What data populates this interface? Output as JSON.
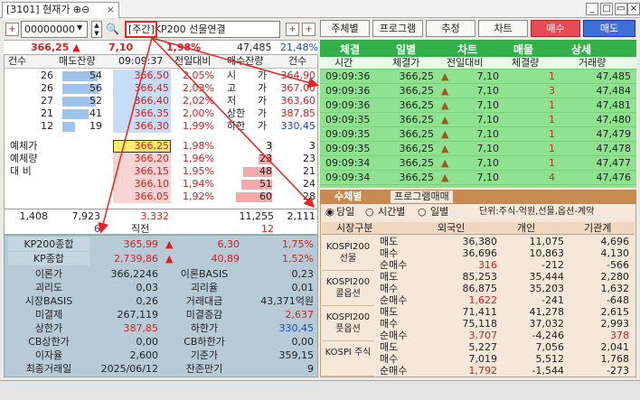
{
  "window": {
    "tab_label": "[3101] 현재가 ⊕⊖",
    "close": "×"
  },
  "toolbar": {
    "code": "00000000",
    "type_tag": "[주간]",
    "product": "KP200 선물연결",
    "b1": "주체별",
    "b2": "프로그램",
    "b3": "추정",
    "b4": "차트",
    "buy": "매수",
    "sell": "매도"
  },
  "summary": {
    "price": "366,25 ▲",
    "change": "7,10",
    "rate": "1,98%",
    "volume": "47,485",
    "ratio": "21,48%"
  },
  "orderbook": {
    "headers": [
      "건수",
      "매도잔량",
      "09:09:37",
      "전일대비",
      "매수잔량",
      "건수"
    ],
    "asks": [
      {
        "cnt": "26",
        "qty": "54",
        "price": "366,50",
        "pct": "2,05%"
      },
      {
        "cnt": "26",
        "qty": "56",
        "price": "366,45",
        "pct": "2,03%"
      },
      {
        "cnt": "27",
        "qty": "52",
        "price": "366,40",
        "pct": "2,02%"
      },
      {
        "cnt": "21",
        "qty": "41",
        "price": "366,35",
        "pct": "2,00%"
      },
      {
        "cnt": "12",
        "qty": "19",
        "price": "366,30",
        "pct": "1,99%"
      }
    ],
    "info": [
      {
        "label": "시",
        "sep": "가",
        "val": "364,90"
      },
      {
        "label": "고",
        "sep": "가",
        "val": "367,00"
      },
      {
        "label": "저",
        "sep": "가",
        "val": "363,60"
      },
      {
        "label": "상한",
        "sep": "가",
        "val": "387,85"
      },
      {
        "label": "하한",
        "sep": "가",
        "val": "330,45"
      }
    ],
    "left_labels": [
      "예체가",
      "예체량",
      "대 비"
    ],
    "bids": [
      {
        "price": "366,25",
        "pct": "1,98%",
        "qty": "3",
        "cnt": "3"
      },
      {
        "price": "366,20",
        "pct": "1,96%",
        "qty": "23",
        "cnt": "23"
      },
      {
        "price": "366,15",
        "pct": "1,95%",
        "qty": "48",
        "cnt": "21"
      },
      {
        "price": "366,10",
        "pct": "1,94%",
        "qty": "51",
        "cnt": "24"
      },
      {
        "price": "366,05",
        "pct": "1,92%",
        "qty": "60",
        "cnt": "28"
      }
    ],
    "foot": {
      "c1": "1,408",
      "c2": "7,923",
      "c3": "3,332",
      "c4": "11,255",
      "c5": "2,111",
      "s1": "6",
      "s2": "직전",
      "s3": "12"
    }
  },
  "bottom": {
    "rows": [
      {
        "l": "KP200종합",
        "v": "365,99",
        "a": "▲",
        "c": "6,30",
        "p": "1,75%"
      },
      {
        "l": "KP종합",
        "v": "2,739,86",
        "a": "▲",
        "c": "40,89",
        "p": "1,52%"
      }
    ],
    "grid": [
      {
        "l1": "이론가",
        "v1": "366,2246",
        "l2": "이론BASIS",
        "v2": "0,23"
      },
      {
        "l1": "괴리도",
        "v1": "0,03",
        "l2": "괴리율",
        "v2": "0,01"
      },
      {
        "l1": "시장BASIS",
        "v1": "0,26",
        "l2": "거래대금",
        "v2": "43,371억원"
      },
      {
        "l1": "미결제",
        "v1": "267,119",
        "l2": "미결증감",
        "v2": "2,637"
      },
      {
        "l1": "상한가",
        "v1": "387,85",
        "l2": "하한가",
        "v2": "330,45"
      },
      {
        "l1": "CB상한가",
        "v1": "0,00",
        "l2": "CB하한가",
        "v2": "0,00"
      },
      {
        "l1": "이자율",
        "v1": "2,600",
        "l2": "기준가",
        "v2": "359,15"
      },
      {
        "l1": "최종거래일",
        "v1": "2025/06/12",
        "l2": "잔존만기",
        "v2": "9"
      }
    ]
  },
  "ticks": {
    "tabs": [
      "체결",
      "일별",
      "차트",
      "매물",
      "상세"
    ],
    "headers": [
      "시간",
      "체결가",
      "전일대비",
      "체결량",
      "거래량"
    ],
    "rows": [
      {
        "t": "09:09:36",
        "p": "366,25",
        "a": "▲",
        "c": "7,10",
        "q": "1",
        "v": "47,485"
      },
      {
        "t": "09:09:36",
        "p": "366,25",
        "a": "▲",
        "c": "7,10",
        "q": "3",
        "v": "47,484"
      },
      {
        "t": "09:09:36",
        "p": "366,25",
        "a": "▲",
        "c": "7,10",
        "q": "1",
        "v": "47,481"
      },
      {
        "t": "09:09:35",
        "p": "366,25",
        "a": "▲",
        "c": "7,10",
        "q": "1",
        "v": "47,480"
      },
      {
        "t": "09:09:35",
        "p": "366,25",
        "a": "▲",
        "c": "7,10",
        "q": "1",
        "v": "47,479"
      },
      {
        "t": "09:09:35",
        "p": "366,25",
        "a": "▲",
        "c": "7,10",
        "q": "1",
        "v": "47,478"
      },
      {
        "t": "09:09:34",
        "p": "366,25",
        "a": "▲",
        "c": "7,10",
        "q": "1",
        "v": "47,477"
      },
      {
        "t": "09:09:34",
        "p": "366,25",
        "a": "▲",
        "c": "7,10",
        "q": "4",
        "v": "47,476"
      }
    ]
  },
  "investor": {
    "tabs": [
      "수체별",
      "프로그램매매"
    ],
    "options": [
      "당일",
      "시간별",
      "일별"
    ],
    "unit": "단위:주식-억원,선물,옵션-계약",
    "headers": [
      "시장구분",
      "외국인",
      "개인",
      "기관계"
    ],
    "groups": [
      {
        "name": "KOSPI200 선물",
        "rows": [
          [
            "매도",
            "36,380",
            "11,075",
            "4,696"
          ],
          [
            "매수",
            "36,696",
            "10,863",
            "4,130"
          ],
          [
            "순매수",
            "316",
            "-212",
            "-566"
          ]
        ]
      },
      {
        "name": "KOSPI200 콜옵션",
        "rows": [
          [
            "매도",
            "85,253",
            "35,444",
            "2,280"
          ],
          [
            "매수",
            "86,875",
            "35,203",
            "1,632"
          ],
          [
            "순매수",
            "1,622",
            "-241",
            "-648"
          ]
        ]
      },
      {
        "name": "KOSPI200 풋옵션",
        "rows": [
          [
            "매도",
            "71,411",
            "41,278",
            "2,615"
          ],
          [
            "매수",
            "75,118",
            "37,032",
            "2,993"
          ],
          [
            "순매수",
            "3,707",
            "-4,246",
            "378"
          ]
        ]
      },
      {
        "name": "KOSPI 주식",
        "rows": [
          [
            "매도",
            "5,227",
            "7,056",
            "2,041"
          ],
          [
            "매수",
            "7,019",
            "5,512",
            "1,768"
          ],
          [
            "순매수",
            "1,792",
            "-1,544",
            "-273"
          ]
        ]
      }
    ]
  }
}
